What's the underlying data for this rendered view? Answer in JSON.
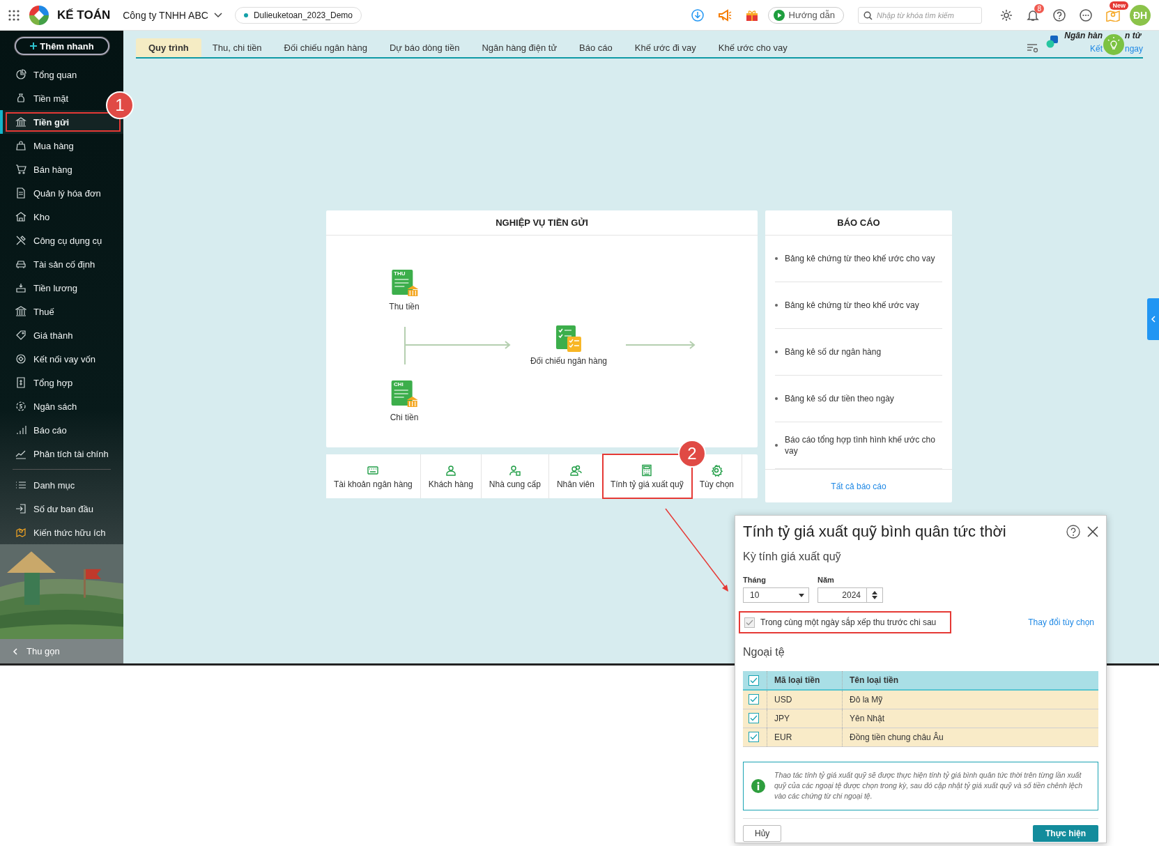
{
  "topbar": {
    "product": "KẾ TOÁN",
    "company": "Công ty TNHH ABC",
    "database": "Dulieuketoan_2023_Demo",
    "guide_button": "Hướng dẫn",
    "search": {
      "placeholder": "Nhập từ khóa tìm kiếm"
    },
    "notification_count": "8",
    "new_badge": "New",
    "avatar": "ĐH"
  },
  "sidebar": {
    "quick_add": "Thêm nhanh",
    "items": [
      {
        "label": "Tổng quan",
        "selected": false,
        "highlighted": false
      },
      {
        "label": "Tiền mặt",
        "selected": false,
        "highlighted": false
      },
      {
        "label": "Tiền gửi",
        "selected": true,
        "highlighted": true,
        "callout": "1"
      },
      {
        "label": "Mua hàng",
        "selected": false,
        "highlighted": false
      },
      {
        "label": "Bán hàng",
        "selected": false,
        "highlighted": false
      },
      {
        "label": "Quản lý hóa đơn",
        "selected": false,
        "highlighted": false
      },
      {
        "label": "Kho",
        "selected": false,
        "highlighted": false
      },
      {
        "label": "Công cụ dụng cụ",
        "selected": false,
        "highlighted": false
      },
      {
        "label": "Tài sản cố định",
        "selected": false,
        "highlighted": false
      },
      {
        "label": "Tiền lương",
        "selected": false,
        "highlighted": false
      },
      {
        "label": "Thuế",
        "selected": false,
        "highlighted": false
      },
      {
        "label": "Giá thành",
        "selected": false,
        "highlighted": false
      },
      {
        "label": "Kết nối vay vốn",
        "selected": false,
        "highlighted": false
      },
      {
        "label": "Tổng hợp",
        "selected": false,
        "highlighted": false
      },
      {
        "label": "Ngân sách",
        "selected": false,
        "highlighted": false
      },
      {
        "label": "Báo cáo",
        "selected": false,
        "highlighted": false
      },
      {
        "label": "Phân tích tài chính",
        "selected": false,
        "highlighted": false
      }
    ],
    "more_items": [
      {
        "label": "Danh mục",
        "selected": false
      },
      {
        "label": "Số dư ban đầu",
        "selected": false
      },
      {
        "label": "Kiến thức hữu ích",
        "selected": false
      }
    ],
    "collapse": "Thu gọn"
  },
  "tabs": [
    {
      "label": "Quy trình",
      "selected": true
    },
    {
      "label": "Thu, chi tiền",
      "selected": false
    },
    {
      "label": "Đối chiếu ngân hàng",
      "selected": false
    },
    {
      "label": "Dự báo dòng tiền",
      "selected": false
    },
    {
      "label": "Ngân hàng điện tử",
      "selected": false
    },
    {
      "label": "Báo cáo",
      "selected": false
    },
    {
      "label": "Khế ước đi vay",
      "selected": false
    },
    {
      "label": "Khế ước cho vay",
      "selected": false
    }
  ],
  "e_banking": {
    "title_parts": [
      "Ngân hàn",
      "n tử"
    ],
    "link_parts": [
      "Kết",
      "ngay"
    ]
  },
  "process": {
    "title": "NGHIỆP VỤ TIỀN GỬI",
    "nodes": [
      {
        "kind": "receipt",
        "tag": "THU",
        "label": "Thu tiền"
      },
      {
        "kind": "receipt",
        "tag": "CHI",
        "label": "Chi tiền"
      },
      {
        "kind": "reconcile",
        "label": "Đối chiếu ngân hàng"
      }
    ]
  },
  "tools": [
    {
      "label": "Tài khoản ngân hàng",
      "highlighted": false
    },
    {
      "label": "Khách hàng",
      "highlighted": false
    },
    {
      "label": "Nhà cung cấp",
      "highlighted": false
    },
    {
      "label": "Nhân viên",
      "highlighted": false
    },
    {
      "label": "Tính tỷ giá xuất quỹ",
      "highlighted": true,
      "callout": "2"
    },
    {
      "label": "Tùy chọn",
      "highlighted": false
    }
  ],
  "reports": {
    "title": "BÁO CÁO",
    "items": [
      "Bảng kê chứng từ theo khế ước cho vay",
      "Bảng kê chứng từ theo khế ước vay",
      "Bảng kê số dư ngân hàng",
      "Bảng kê số dư tiền theo ngày",
      "Báo cáo tổng hợp tình hình khế ước cho vay"
    ],
    "all_link": "Tất cả báo cáo"
  },
  "dialog": {
    "title": "Tính tỷ giá xuất quỹ bình quân tức thời",
    "period_heading": "Kỳ tính giá xuất quỹ",
    "month": {
      "label": "Tháng",
      "value": "10"
    },
    "year": {
      "label": "Năm",
      "value": "2024"
    },
    "order_option": {
      "label": "Trong cùng một ngày sắp xếp thu trước chi sau",
      "checked": true,
      "disabled": true,
      "highlighted": true
    },
    "change_options_link": "Thay đổi tùy chọn",
    "currency_heading": "Ngoại tệ",
    "columns": [
      "Mã loại tiền",
      "Tên loại tiền"
    ],
    "all_checked": true,
    "rows": [
      {
        "code": "USD",
        "name": "Đô la Mỹ",
        "checked": true
      },
      {
        "code": "JPY",
        "name": "Yên Nhật",
        "checked": true
      },
      {
        "code": "EUR",
        "name": "Đồng tiền chung châu Âu",
        "checked": true
      }
    ],
    "info": "Thao tác tính tỷ giá xuất quỹ sẽ được thực hiện tính tỷ giá bình quân tức thời trên từng lần xuất quỹ của các ngoại tệ được chọn trong kỳ, sau đó cập nhật tỷ giá xuất quỹ và số tiền chênh lệch vào các chứng từ chi ngoại tệ.",
    "cancel_button": "Hủy",
    "run_button": "Thực hiện"
  }
}
